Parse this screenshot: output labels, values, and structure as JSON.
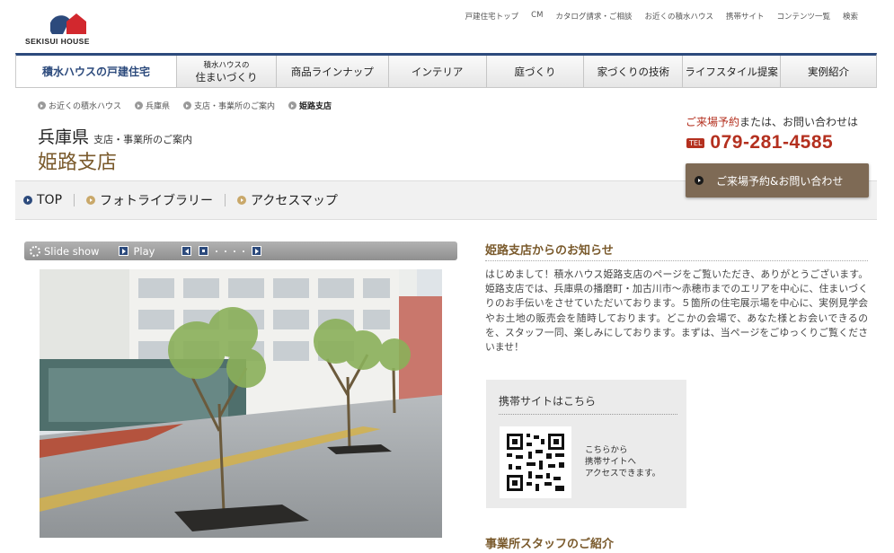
{
  "logo": {
    "text": "SEKISUI HOUSE"
  },
  "top_nav": [
    "戸建住宅トップ",
    "CM",
    "カタログ請求・ご相談",
    "お近くの積水ハウス",
    "携帯サイト",
    "コンテンツ一覧",
    "検索"
  ],
  "main_nav": {
    "home": "積水ハウスの戸建住宅",
    "sumai_line1": "積水ハウスの",
    "sumai_line2": "住まいづくり",
    "items": [
      "商品ラインナップ",
      "インテリア",
      "庭づくり",
      "家づくりの技術",
      "ライフスタイル提案",
      "実例紹介"
    ]
  },
  "breadcrumb": [
    "お近くの積水ハウス",
    "兵庫県",
    "支店・事業所のご案内",
    "姫路支店"
  ],
  "page": {
    "prefecture": "兵庫県",
    "subtitle": "支店・事業所のご案内",
    "branch": "姫路支店"
  },
  "contact": {
    "highlight": "ご来場予約",
    "rest": "または、お問い合わせは",
    "tel_badge": "TEL",
    "tel": "079-281-4585",
    "button": "ご来場予約&お問い合わせ"
  },
  "tabs": [
    "TOP",
    "フォトライブラリー",
    "アクセスマップ"
  ],
  "slideshow": {
    "label": "Slide show",
    "play": "Play"
  },
  "news": {
    "title": "姫路支店からのお知らせ",
    "body": "はじめまして！積水ハウス姫路支店のページをご覧いただき、ありがとうございます。姫路支店では、兵庫県の播磨町・加古川市～赤穂市までのエリアを中心に、住まいづくりのお手伝いをさせていただいております。５箇所の住宅展示場を中心に、実例見学会やお土地の販売会を随時しております。どこかの会場で、あなた様とお会いできるのを、スタッフ一同、楽しみにしております。まずは、当ページをごゆっくりご覧くださいませ！"
  },
  "mobile": {
    "title": "携帯サイトはこちら",
    "line1": "こちらから",
    "line2": "携帯サイトへ",
    "line3": "アクセスできます。"
  },
  "staff": {
    "title": "事業所スタッフのご紹介"
  },
  "colors": {
    "navy": "#2c4a7c",
    "brown": "#7a5a2c",
    "red": "#b4301f",
    "cta": "#7e6a55"
  }
}
